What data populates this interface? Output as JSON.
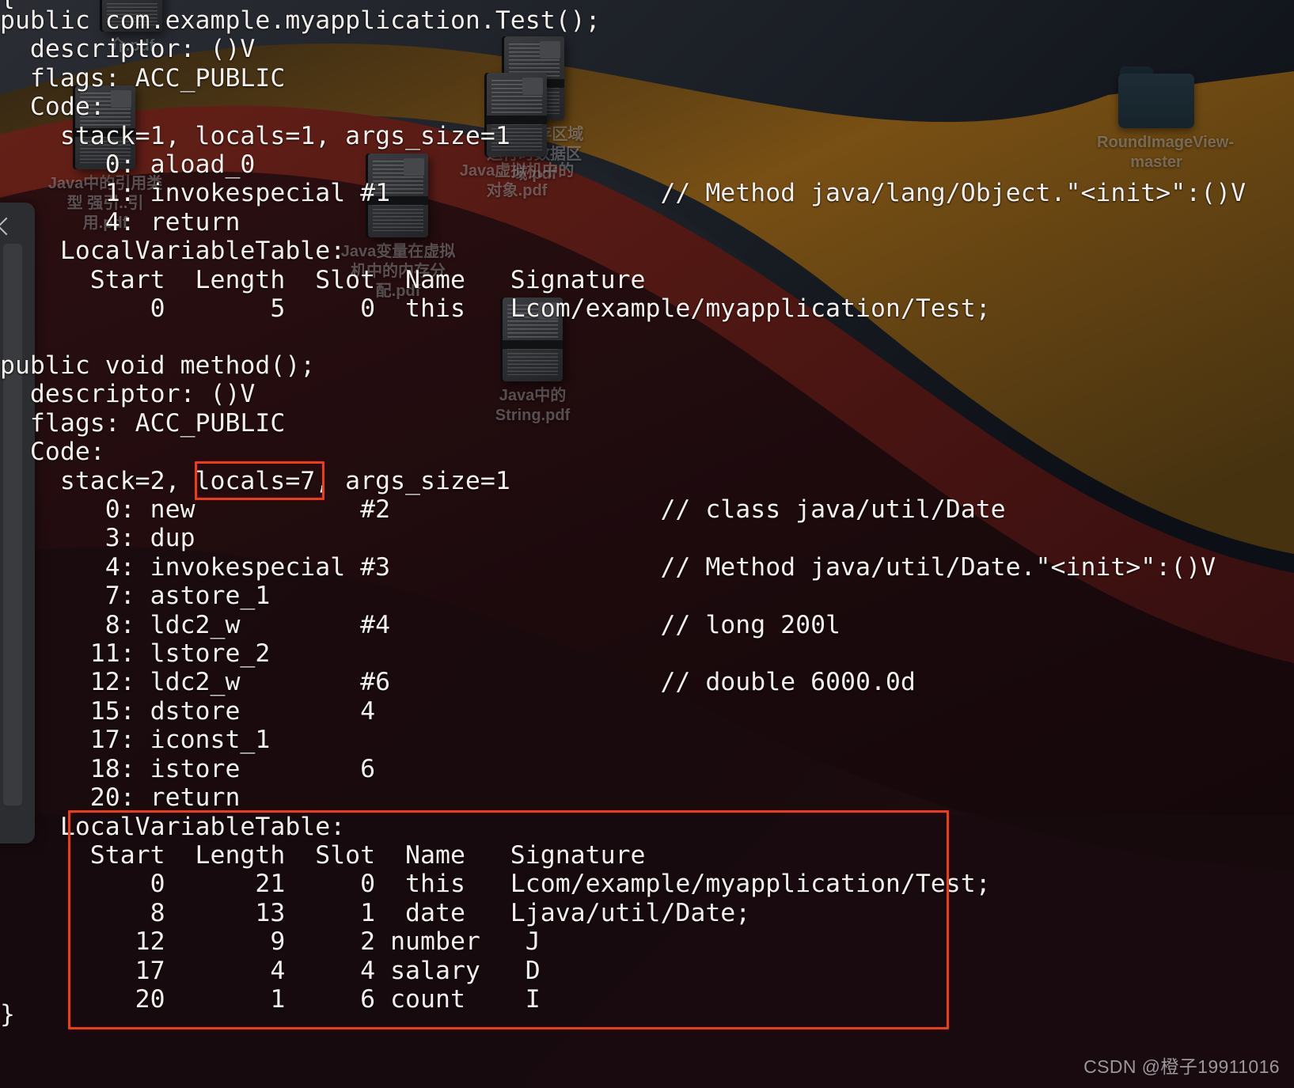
{
  "window": {
    "app": "Terminal",
    "kind": "javap-bytecode-output"
  },
  "watermark": "CSDN @橙子19911016",
  "desktop": {
    "icons": [
      {
        "name": "icon-java-memory-area-pdf",
        "type": "pdf-document",
        "label": "Java内存区域 运行时数据区域.pdf"
      },
      {
        "name": "icon-java-intro-pdf",
        "type": "pdf-document",
        "label": "介.pdf"
      },
      {
        "name": "icon-java-object-in-jvm-pdf",
        "type": "pdf-document",
        "label": "Java虚拟机中的对象.pdf"
      },
      {
        "name": "icon-java-reference-types-pdf",
        "type": "pdf-document",
        "label": "Java中的引用类型 强引..引用.pdf"
      },
      {
        "name": "icon-java-variable-memory-pdf",
        "type": "pdf-document",
        "label": "Java变量在虚拟机中的内存分配.pdf"
      },
      {
        "name": "icon-java-string-pdf",
        "type": "pdf-document",
        "label": "Java中的String.pdf"
      },
      {
        "name": "icon-roundimageview-folder",
        "type": "folder",
        "label": "RoundImageView-master"
      }
    ]
  },
  "colors": {
    "annotation": "#f23a17",
    "terminal_text": "#f2efec",
    "terminal_bg": "#1b0d10",
    "wallpaper_dark": "#12161c",
    "wallpaper_maroon": "#5c1512",
    "wallpaper_amber": "#8a5a16"
  },
  "terminal": {
    "top_brace": "{",
    "bottom_brace": "}",
    "block_a": "public com.example.myapplication.Test();\n  descriptor: ()V\n  flags: ACC_PUBLIC\n  Code:\n    stack=1, locals=1, args_size=1\n       0: aload_0\n       1: invokespecial #1                  // Method java/lang/Object.\"<init>\":()V\n       4: return\n    LocalVariableTable:\n      Start  Length  Slot  Name   Signature\n          0       5     0  this   Lcom/example/myapplication/Test;",
    "block_b": "public void method();\n  descriptor: ()V\n  flags: ACC_PUBLIC\n  Code:\n    stack=2, locals=7, args_size=1\n       0: new           #2                  // class java/util/Date\n       3: dup\n       4: invokespecial #3                  // Method java/util/Date.\"<init>\":()V\n       7: astore_1\n       8: ldc2_w        #4                  // long 200l\n      11: lstore_2\n      12: ldc2_w        #6                  // double 6000.0d\n      15: dstore        4\n      17: iconst_1\n      18: istore        6\n      20: return\n    LocalVariableTable:\n      Start  Length  Slot  Name   Signature\n          0      21     0  this   Lcom/example/myapplication/Test;\n          8      13     1  date   Ljava/util/Date;\n         12       9     2 number   J\n         17       4     4 salary   D\n         20       1     6 count    I"
  },
  "annotations": {
    "locals_box": {
      "label": "locals=7",
      "note": "highlighted locals count"
    },
    "lvt_box": {
      "label": "LocalVariableTable",
      "note": "highlighted local variable table of method()"
    }
  },
  "methods": [
    {
      "signature": "public com.example.myapplication.Test();",
      "descriptor": "()V",
      "flags": "ACC_PUBLIC",
      "stack": 1,
      "locals": 1,
      "args_size": 1,
      "instructions": [
        {
          "offset": "0",
          "opcode": "aload_0",
          "operand": "",
          "comment": ""
        },
        {
          "offset": "1",
          "opcode": "invokespecial",
          "operand": "#1",
          "comment": "// Method java/lang/Object.\"<init>\":()V"
        },
        {
          "offset": "4",
          "opcode": "return",
          "operand": "",
          "comment": ""
        }
      ],
      "local_variable_table": {
        "headers": [
          "Start",
          "Length",
          "Slot",
          "Name",
          "Signature"
        ],
        "rows": [
          [
            "0",
            "5",
            "0",
            "this",
            "Lcom/example/myapplication/Test;"
          ]
        ]
      }
    },
    {
      "signature": "public void method();",
      "descriptor": "()V",
      "flags": "ACC_PUBLIC",
      "stack": 2,
      "locals": 7,
      "args_size": 1,
      "instructions": [
        {
          "offset": "0",
          "opcode": "new",
          "operand": "#2",
          "comment": "// class java/util/Date"
        },
        {
          "offset": "3",
          "opcode": "dup",
          "operand": "",
          "comment": ""
        },
        {
          "offset": "4",
          "opcode": "invokespecial",
          "operand": "#3",
          "comment": "// Method java/util/Date.\"<init>\":()V"
        },
        {
          "offset": "7",
          "opcode": "astore_1",
          "operand": "",
          "comment": ""
        },
        {
          "offset": "8",
          "opcode": "ldc2_w",
          "operand": "#4",
          "comment": "// long 200l"
        },
        {
          "offset": "11",
          "opcode": "lstore_2",
          "operand": "",
          "comment": ""
        },
        {
          "offset": "12",
          "opcode": "ldc2_w",
          "operand": "#6",
          "comment": "// double 6000.0d"
        },
        {
          "offset": "15",
          "opcode": "dstore",
          "operand": "4",
          "comment": ""
        },
        {
          "offset": "17",
          "opcode": "iconst_1",
          "operand": "",
          "comment": ""
        },
        {
          "offset": "18",
          "opcode": "istore",
          "operand": "6",
          "comment": ""
        },
        {
          "offset": "20",
          "opcode": "return",
          "operand": "",
          "comment": ""
        }
      ],
      "local_variable_table": {
        "headers": [
          "Start",
          "Length",
          "Slot",
          "Name",
          "Signature"
        ],
        "rows": [
          [
            "0",
            "21",
            "0",
            "this",
            "Lcom/example/myapplication/Test;"
          ],
          [
            "8",
            "13",
            "1",
            "date",
            "Ljava/util/Date;"
          ],
          [
            "12",
            "9",
            "2",
            "number",
            "J"
          ],
          [
            "17",
            "4",
            "4",
            "salary",
            "D"
          ],
          [
            "20",
            "1",
            "6",
            "count",
            "I"
          ]
        ]
      }
    }
  ]
}
